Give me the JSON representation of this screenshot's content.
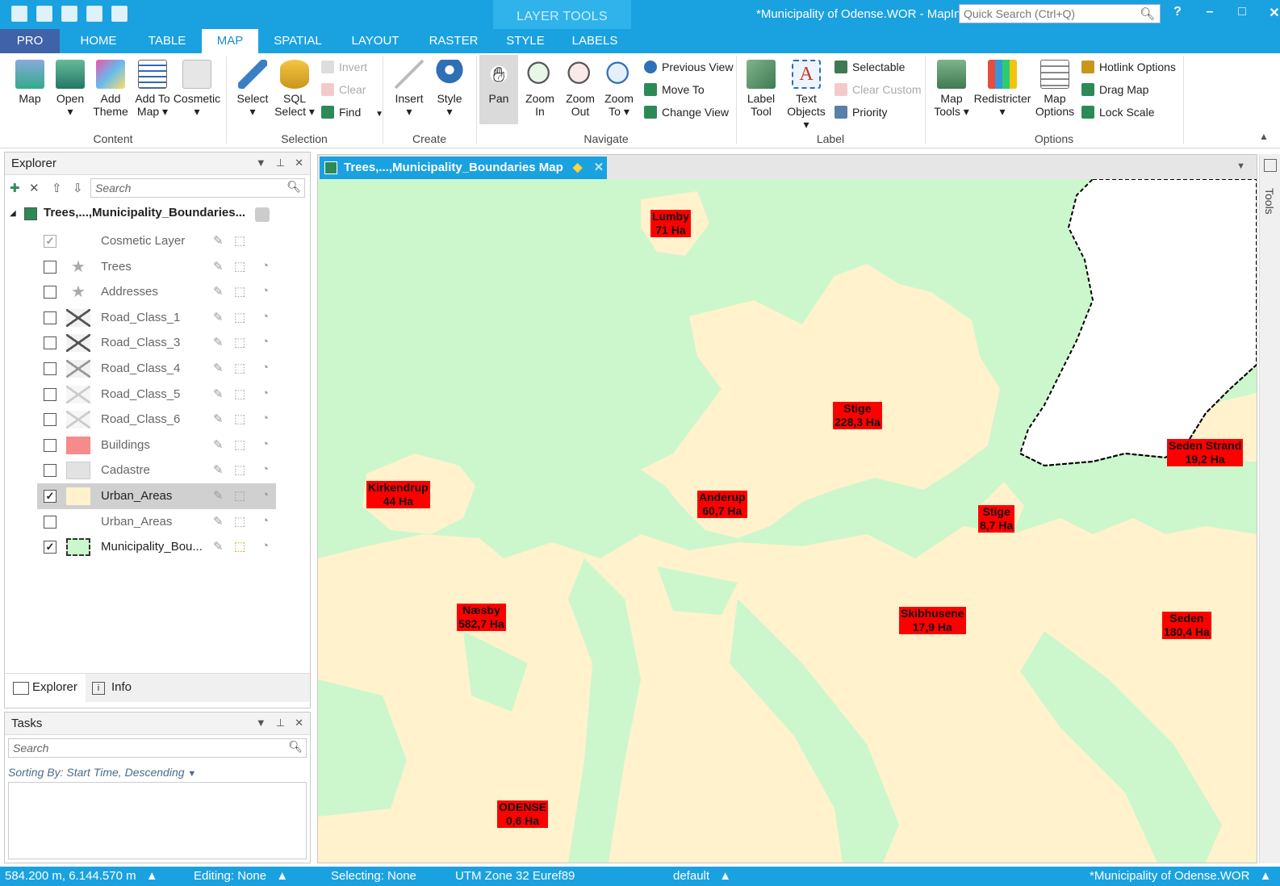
{
  "window": {
    "title": "*Municipality of Odense.WOR - MapIn",
    "quick_search_placeholder": "Quick Search (Ctrl+Q)",
    "contextual_tab_group": "LAYER TOOLS",
    "controls": {
      "help": "?",
      "minimize": "–",
      "maximize": "□",
      "close": "✕"
    }
  },
  "tabs": [
    "PRO",
    "HOME",
    "TABLE",
    "MAP",
    "SPATIAL",
    "LAYOUT",
    "RASTER",
    "STYLE",
    "LABELS"
  ],
  "active_tab": "MAP",
  "ribbon": {
    "content": {
      "label": "Content",
      "buttons": [
        {
          "label": "Map",
          "sub": "",
          "icon": "map-icon"
        },
        {
          "label": "Open",
          "sub": "▾",
          "icon": "open-icon"
        },
        {
          "label": "Add",
          "sub": "Theme",
          "icon": "add-theme-icon"
        },
        {
          "label": "Add To",
          "sub": "Map ▾",
          "icon": "add-to-map-icon"
        },
        {
          "label": "Cosmetic",
          "sub": "▾",
          "icon": "cosmetic-icon"
        }
      ]
    },
    "selection": {
      "label": "Selection",
      "buttons": [
        {
          "label": "Select",
          "sub": "▾",
          "icon": "select-arrow-icon"
        },
        {
          "label": "SQL",
          "sub": "Select ▾",
          "icon": "sql-select-icon"
        }
      ],
      "small": [
        {
          "label": "Invert",
          "icon": "invert-icon",
          "disabled": true
        },
        {
          "label": "Clear",
          "icon": "clear-icon",
          "disabled": true
        },
        {
          "label": "Find",
          "icon": "find-icon",
          "disabled": false
        }
      ]
    },
    "create": {
      "label": "Create",
      "buttons": [
        {
          "label": "Insert",
          "sub": "▾",
          "icon": "insert-icon"
        },
        {
          "label": "Style",
          "sub": "▾",
          "icon": "style-icon"
        }
      ]
    },
    "navigate": {
      "label": "Navigate",
      "buttons": [
        {
          "label": "Pan",
          "sub": "",
          "icon": "pan-hand-icon"
        },
        {
          "label": "Zoom",
          "sub": "In",
          "icon": "zoom-in-icon"
        },
        {
          "label": "Zoom",
          "sub": "Out",
          "icon": "zoom-out-icon"
        },
        {
          "label": "Zoom",
          "sub": "To ▾",
          "icon": "zoom-to-icon"
        }
      ],
      "small": [
        {
          "label": "Previous View",
          "icon": "previous-view-icon"
        },
        {
          "label": "Move To",
          "icon": "move-to-icon"
        },
        {
          "label": "Change View",
          "icon": "change-view-icon"
        }
      ]
    },
    "label_group": {
      "label": "Label",
      "buttons": [
        {
          "label": "Label",
          "sub": "Tool",
          "icon": "label-tool-icon"
        },
        {
          "label": "Text",
          "sub": "Objects ▾",
          "icon": "text-objects-icon"
        }
      ],
      "small": [
        {
          "label": "Selectable",
          "icon": "selectable-icon",
          "disabled": false
        },
        {
          "label": "Clear Custom",
          "icon": "clear-custom-icon",
          "disabled": true
        },
        {
          "label": "Priority",
          "icon": "priority-icon",
          "disabled": false
        }
      ]
    },
    "options": {
      "label": "Options",
      "buttons": [
        {
          "label": "Map",
          "sub": "Tools ▾",
          "icon": "map-tools-icon"
        },
        {
          "label": "Redistricter",
          "sub": "▾",
          "icon": "redistricter-icon"
        },
        {
          "label": "Map",
          "sub": "Options",
          "icon": "map-options-icon"
        }
      ],
      "small": [
        {
          "label": "Hotlink Options",
          "icon": "hotlink-icon"
        },
        {
          "label": "Drag Map",
          "icon": "drag-map-icon"
        },
        {
          "label": "Lock Scale",
          "icon": "lock-scale-icon"
        }
      ]
    }
  },
  "explorer": {
    "title": "Explorer",
    "search_placeholder": "Search",
    "root_map": "Trees,...,Municipality_Boundaries...",
    "layers": [
      {
        "name": "Cosmetic Layer",
        "checked": true,
        "dim": true,
        "swatch": "none"
      },
      {
        "name": "Trees",
        "checked": false,
        "dim": true,
        "swatch": "star"
      },
      {
        "name": "Addresses",
        "checked": false,
        "dim": true,
        "swatch": "star"
      },
      {
        "name": "Road_Class_1",
        "checked": false,
        "dim": true,
        "swatch": "line-dark"
      },
      {
        "name": "Road_Class_3",
        "checked": false,
        "dim": true,
        "swatch": "line-dark"
      },
      {
        "name": "Road_Class_4",
        "checked": false,
        "dim": true,
        "swatch": "line-mid"
      },
      {
        "name": "Road_Class_5",
        "checked": false,
        "dim": true,
        "swatch": "line-light"
      },
      {
        "name": "Road_Class_6",
        "checked": false,
        "dim": true,
        "swatch": "line-light"
      },
      {
        "name": "Buildings",
        "checked": false,
        "dim": true,
        "swatch": "buildings"
      },
      {
        "name": "Cadastre",
        "checked": false,
        "dim": true,
        "swatch": "cadastre"
      },
      {
        "name": "Urban_Areas",
        "checked": true,
        "dim": false,
        "swatch": "urban",
        "selected": true
      },
      {
        "name": "Urban_Areas",
        "checked": false,
        "dim": true,
        "swatch": "none"
      },
      {
        "name": "Municipality_Bou...",
        "checked": true,
        "dim": false,
        "swatch": "boundary"
      }
    ],
    "bottom_tabs": [
      "Explorer",
      "Info"
    ]
  },
  "tasks": {
    "title": "Tasks",
    "search_placeholder": "Search",
    "sorting": "Sorting By: Start Time, Descending"
  },
  "map_window": {
    "tab_title": "Trees,...,Municipality_Boundaries Map",
    "tools_strip": "Tools",
    "colors": {
      "background": "#ccf7cc",
      "urban": "#fff2cc",
      "sea": "#ffffff",
      "label_bg": "#ff0000"
    },
    "labels": [
      {
        "name": "Lumby",
        "area": "71 Ha"
      },
      {
        "name": "Stige",
        "area": "228,3 Ha"
      },
      {
        "name": "Seden Strand",
        "area": "19,2 Ha"
      },
      {
        "name": "Kirkendrup",
        "area": "44 Ha"
      },
      {
        "name": "Anderup",
        "area": "60,7 Ha"
      },
      {
        "name": "Stige",
        "area": "8,7 Ha"
      },
      {
        "name": "Næsby",
        "area": "582,7 Ha"
      },
      {
        "name": "Skibhusene",
        "area": "17,9 Ha"
      },
      {
        "name": "Seden",
        "area": "180,4 Ha"
      },
      {
        "name": "ODENSE",
        "area": "0,6 Ha"
      }
    ]
  },
  "status": {
    "coords": "584.200 m, 6.144.570 m",
    "editing": "Editing: None",
    "selecting": "Selecting: None",
    "projection": "UTM Zone 32 Euref89",
    "style": "default",
    "workspace": "*Municipality of Odense.WOR"
  }
}
